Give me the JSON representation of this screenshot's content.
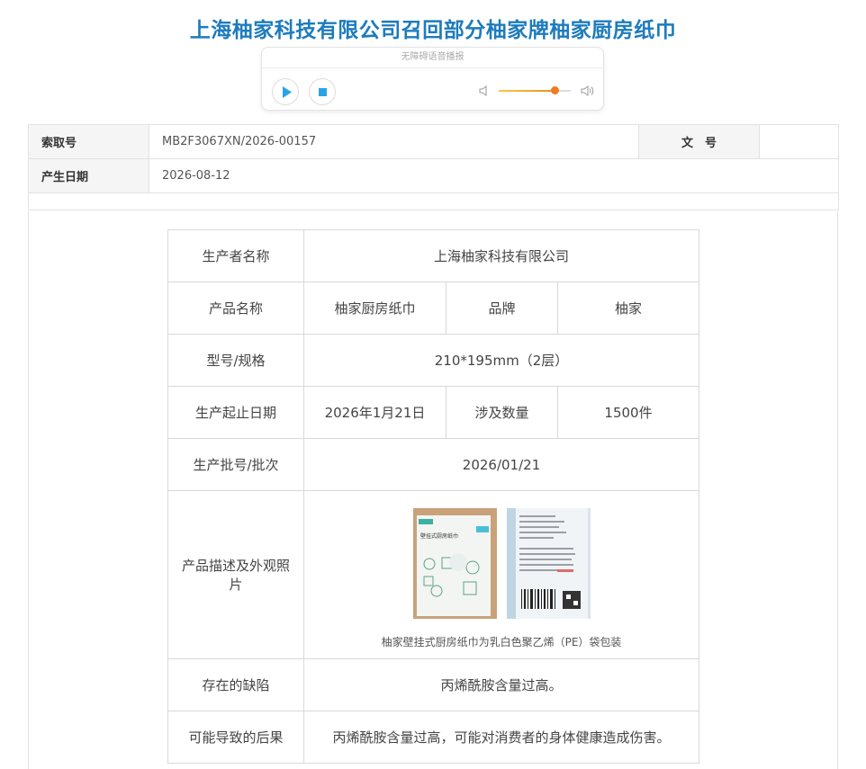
{
  "page_title": "上海柚家科技有限公司召回部分柚家牌柚家厨房纸巾",
  "player": {
    "label": "无障碍语音播报",
    "volume_percent": 78
  },
  "meta": {
    "index_label": "索取号",
    "index_value": "MB2F3067XN/2026-00157",
    "doc_no_label": "文　号",
    "doc_no_value": "",
    "date_label": "产生日期",
    "date_value": "2026-08-12"
  },
  "detail": {
    "producer_label": "生产者名称",
    "producer_value": "上海柚家科技有限公司",
    "product_label": "产品名称",
    "product_value": "柚家厨房纸巾",
    "brand_label": "品牌",
    "brand_value": "柚家",
    "model_label": "型号/规格",
    "model_value": "210*195mm（2层）",
    "date_label": "生产起止日期",
    "date_value": "2026年1月21日",
    "qty_label": "涉及数量",
    "qty_value": "1500件",
    "batch_label": "生产批号/批次",
    "batch_value": "2026/01/21",
    "desc_label": "产品描述及外观照片",
    "desc_caption": "柚家壁挂式厨房纸巾为乳白色聚乙烯（PE）袋包装",
    "photo_front_text": "壁挂式厨房纸巾",
    "defect_label": "存在的缺陷",
    "defect_value": "丙烯酰胺含量过高。",
    "consequence_label": "可能导致的后果",
    "consequence_value": "丙烯酰胺含量过高，可能对消费者的身体健康造成伤害。"
  },
  "colors": {
    "title": "#1d7bbd",
    "accent_blue": "#2aa3e6",
    "slider": "#f07a1f"
  }
}
